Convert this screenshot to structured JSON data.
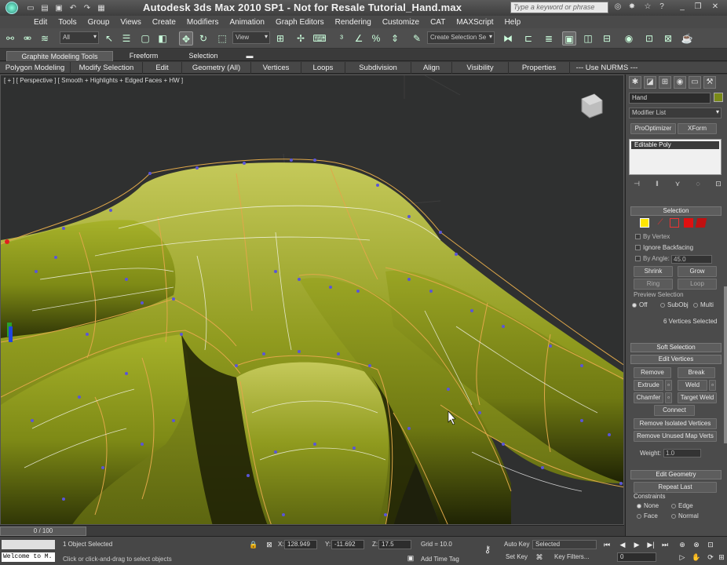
{
  "titlebar": {
    "title": "Autodesk 3ds Max  2010 SP1   - Not for Resale   Tutorial_Hand.max",
    "search_placeholder": "Type a keyword or phrase"
  },
  "menu": [
    "Edit",
    "Tools",
    "Group",
    "Views",
    "Create",
    "Modifiers",
    "Animation",
    "Graph Editors",
    "Rendering",
    "Customize",
    "CAT",
    "MAXScript",
    "Help"
  ],
  "toolbar": {
    "selection_filter": "All",
    "ref_coord": "View",
    "named_selection_placeholder": "Create Selection Se"
  },
  "ribbon": {
    "tabs": [
      "Graphite Modeling Tools",
      "Freeform",
      "Selection"
    ],
    "panels": [
      "Polygon Modeling",
      "Modify Selection",
      "Edit",
      "Geometry (All)",
      "Vertices",
      "Loops",
      "Subdivision",
      "Align",
      "Visibility",
      "Properties",
      "--- Use NURMS ---"
    ]
  },
  "viewport": {
    "label": "[ + ] [ Perspective ] [ Smooth + Highlights + Edged Faces + HW ]"
  },
  "command_panel": {
    "object_name": "Hand",
    "modifier_list": "Modifier List",
    "pro_optimizer": "ProOptimizer",
    "xform": "XForm",
    "stack_item": "Editable Poly",
    "selection": {
      "header": "Selection",
      "by_vertex": "By Vertex",
      "ignore_backfacing": "Ignore Backfacing",
      "by_angle": "By Angle:",
      "angle_value": "45.0",
      "shrink": "Shrink",
      "grow": "Grow",
      "ring": "Ring",
      "loop": "Loop",
      "preview_selection": "Preview Selection",
      "preview_off": "Off",
      "preview_subobj": "SubObj",
      "preview_multi": "Multi",
      "status": "6 Vertices Selected"
    },
    "soft_selection": "Soft Selection",
    "edit_vertices": {
      "header": "Edit Vertices",
      "remove": "Remove",
      "break": "Break",
      "extrude": "Extrude",
      "weld": "Weld",
      "chamfer": "Chamfer",
      "target_weld": "Target Weld",
      "connect": "Connect",
      "remove_isolated": "Remove Isolated Vertices",
      "remove_unused": "Remove Unused Map Verts",
      "weight_label": "Weight:",
      "weight_value": "1.0"
    },
    "edit_geometry": {
      "header": "Edit Geometry",
      "repeat_last": "Repeat Last",
      "constraints": "Constraints",
      "none": "None",
      "edge": "Edge",
      "face": "Face",
      "normal": "Normal"
    }
  },
  "timeline": {
    "frame": "0 / 100"
  },
  "status": {
    "listener": "Welcome to M.",
    "selected": "1 Object Selected",
    "prompt": "Click or click-and-drag to select objects",
    "x_label": "X:",
    "x": "128.949",
    "y_label": "Y:",
    "y": "-11.692",
    "z_label": "Z:",
    "z": "17.5",
    "grid": "Grid = 10.0",
    "add_time_tag": "Add Time Tag",
    "auto_key": "Auto Key",
    "set_key": "Set Key",
    "key_mode": "Selected",
    "key_filters": "Key Filters...",
    "current_frame": "0"
  }
}
